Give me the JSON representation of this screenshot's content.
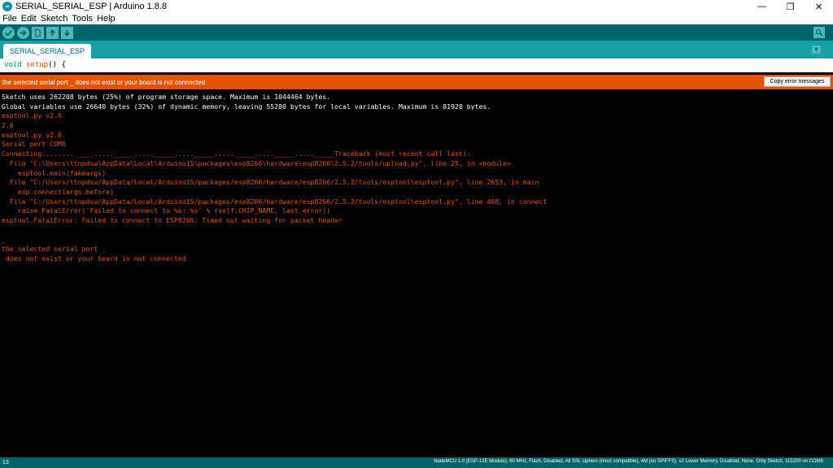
{
  "window": {
    "title": "SERIAL_SERIAL_ESP | Arduino 1.8.8",
    "app_icon": "arduino-logo-icon",
    "minimize_glyph": "—",
    "maximize_glyph": "❐",
    "close_glyph": "✕"
  },
  "menu": [
    {
      "label": "File"
    },
    {
      "label": "Edit"
    },
    {
      "label": "Sketch"
    },
    {
      "label": "Tools"
    },
    {
      "label": "Help"
    }
  ],
  "toolbar": {
    "buttons": [
      "verify-icon",
      "upload-icon",
      "new-icon",
      "open-icon",
      "save-icon"
    ],
    "serial_monitor_icon": "magnifier-icon"
  },
  "tabs": {
    "active": "SERIAL_SERIAL_ESP",
    "menu_icon": "dropdown-triangle-icon"
  },
  "editor": {
    "keyword": "void",
    "function": "setup",
    "rest": "() {"
  },
  "status": {
    "message": "the selected serial port _ does not exist or your board is not connected",
    "copy_button": "Copy error messages"
  },
  "console": {
    "lines": [
      {
        "text": "Sketch uses 262208 bytes (25%) of program storage space. Maximum is 1044464 bytes.",
        "color": "white"
      },
      {
        "text": "Global variables use 26640 bytes (32%) of dynamic memory, leaving 55280 bytes for local variables. Maximum is 81920 bytes.",
        "color": "white"
      },
      {
        "text": "esptool.py v2.6",
        "color": "orange"
      },
      {
        "text": "2.6",
        "color": "orange"
      },
      {
        "text": "esptool.py v2.6",
        "color": "orange"
      },
      {
        "text": "Serial port COM6",
        "color": "orange"
      },
      {
        "text": "Connecting........_____....._____....._____....._____....._____....._____....._____Traceback (most recent call last):",
        "color": "orange"
      },
      {
        "text": "  File \"C:\\Users\\ttnpdsw\\AppData\\Local\\Arduino15\\packages\\esp8266\\hardware\\esp8266\\2.5.2/tools/upload.py\", line 25, in <module>",
        "color": "orange"
      },
      {
        "text": "    esptool.main(fakeargs)",
        "color": "orange"
      },
      {
        "text": "  File \"C:/Users/ttnpdsw/AppData/Local/Arduino15/packages/esp8266/hardware/esp8266/2.5.2/tools/esptool\\esptool.py\", line 2653, in main",
        "color": "orange"
      },
      {
        "text": "    esp.connect(args.before)",
        "color": "orange"
      },
      {
        "text": "  File \"C:/Users/ttnpdsw/AppData/Local/Arduino15/packages/esp8266/hardware/esp8266/2.5.2/tools/esptool\\esptool.py\", line 468, in connect",
        "color": "orange"
      },
      {
        "text": "    raise FatalError('Failed to connect to %s: %s' % (self.CHIP_NAME, last_error))",
        "color": "orange"
      },
      {
        "text": "esptool.FatalError: Failed to connect to ESP8266: Timed out waiting for packet header",
        "color": "orange"
      },
      {
        "text": "",
        "color": "orange"
      },
      {
        "text": "_",
        "color": "orange"
      },
      {
        "text": "the selected serial port _",
        "color": "orange"
      },
      {
        "text": " does not exist or your board is not connected",
        "color": "orange"
      }
    ]
  },
  "footer": {
    "line_number": "13",
    "board": "NodeMCU 1.0 (ESP-12E Module), 80 MHz, Flash, Disabled, All SSL ciphers (most compatible), 4M (no SPIFFS), v2 Lower Memory, Disabled, None, Only Sketch, 115200 on COM6"
  },
  "colors": {
    "teal_dark": "#006468",
    "teal_tab": "#17a1a5",
    "error_orange": "#e35400",
    "console_bg": "#000000"
  }
}
